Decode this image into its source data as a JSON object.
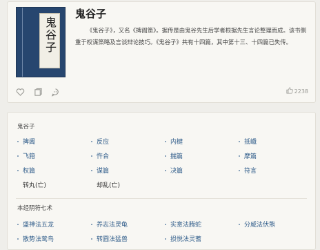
{
  "book": {
    "title": "鬼谷子",
    "cover_text": "鬼谷子",
    "description": "《鬼谷子》，又名《捭阖策》。据传是由鬼谷先生后学者根据先生言论整理而成。该书侧重于权谋策略及言谈辩论技巧。《鬼谷子》共有十四篇，其中第十三、十四篇已失传。",
    "likes": "2238"
  },
  "actions": {
    "icons": [
      "heart-icon",
      "copy-icon",
      "share-icon"
    ],
    "like_icon": "thumb-up-icon"
  },
  "section1": {
    "heading": "鬼谷子",
    "items": [
      {
        "label": "捭阖",
        "link": true
      },
      {
        "label": "反应",
        "link": true
      },
      {
        "label": "内楗",
        "link": true
      },
      {
        "label": "抵巇",
        "link": true
      },
      {
        "label": "飞箝",
        "link": true
      },
      {
        "label": "忤合",
        "link": true
      },
      {
        "label": "揣篇",
        "link": true
      },
      {
        "label": "摩篇",
        "link": true
      },
      {
        "label": "权篇",
        "link": true
      },
      {
        "label": "谋篇",
        "link": true
      },
      {
        "label": "决篇",
        "link": true
      },
      {
        "label": "符言",
        "link": true
      },
      {
        "label": "转丸(亡)",
        "link": false
      },
      {
        "label": "却乱(亡)",
        "link": false
      }
    ]
  },
  "section2": {
    "heading": "本经阴符七术",
    "items": [
      {
        "label": "盛神法五龙",
        "link": true
      },
      {
        "label": "养志法灵龟",
        "link": true
      },
      {
        "label": "实意法腾蛇",
        "link": true
      },
      {
        "label": "分威法伏熊",
        "link": true
      },
      {
        "label": "散势法鸷鸟",
        "link": true
      },
      {
        "label": "转圆法猛兽",
        "link": true
      },
      {
        "label": "损悦法灵蓍",
        "link": true
      }
    ]
  },
  "colors": {
    "link": "#2f5c8a",
    "cover": "#27466f",
    "background": "#efeeea",
    "card": "#f8f7f3"
  }
}
